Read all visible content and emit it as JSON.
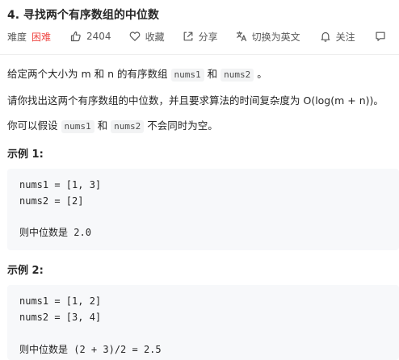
{
  "problem": {
    "title": "4. 寻找两个有序数组的中位数",
    "difficulty_label": "难度",
    "difficulty_value": "困难",
    "likes": "2404",
    "favorite_label": "收藏",
    "share_label": "分享",
    "switch_lang_label": "切换为英文",
    "follow_label": "关注",
    "colors": {
      "difficulty_hard": "#ef4743",
      "text": "#262626",
      "meta": "#595959",
      "code_bg": "#f7f8fa"
    }
  },
  "description": {
    "p1_before": "给定两个大小为 m 和 n 的有序数组",
    "p1_code1": "nums1",
    "p1_mid": "和",
    "p1_code2": "nums2",
    "p1_after": "。",
    "p2": "请你找出这两个有序数组的中位数，并且要求算法的时间复杂度为 O(log(m + n))。",
    "p3_before": "你可以假设",
    "p3_code1": "nums1",
    "p3_mid": "和",
    "p3_code2": "nums2",
    "p3_after": "不会同时为空。"
  },
  "examples": [
    {
      "title": "示例 1:",
      "line1": "nums1 = [1, 3]",
      "line2": "nums2 = [2]",
      "result_label": "则中位数是",
      "result_value": "2.0"
    },
    {
      "title": "示例 2:",
      "line1": "nums1 = [1, 2]",
      "line2": "nums2 = [3, 4]",
      "result_label": "则中位数是",
      "result_value": "(2 + 3)/2 = 2.5"
    }
  ]
}
